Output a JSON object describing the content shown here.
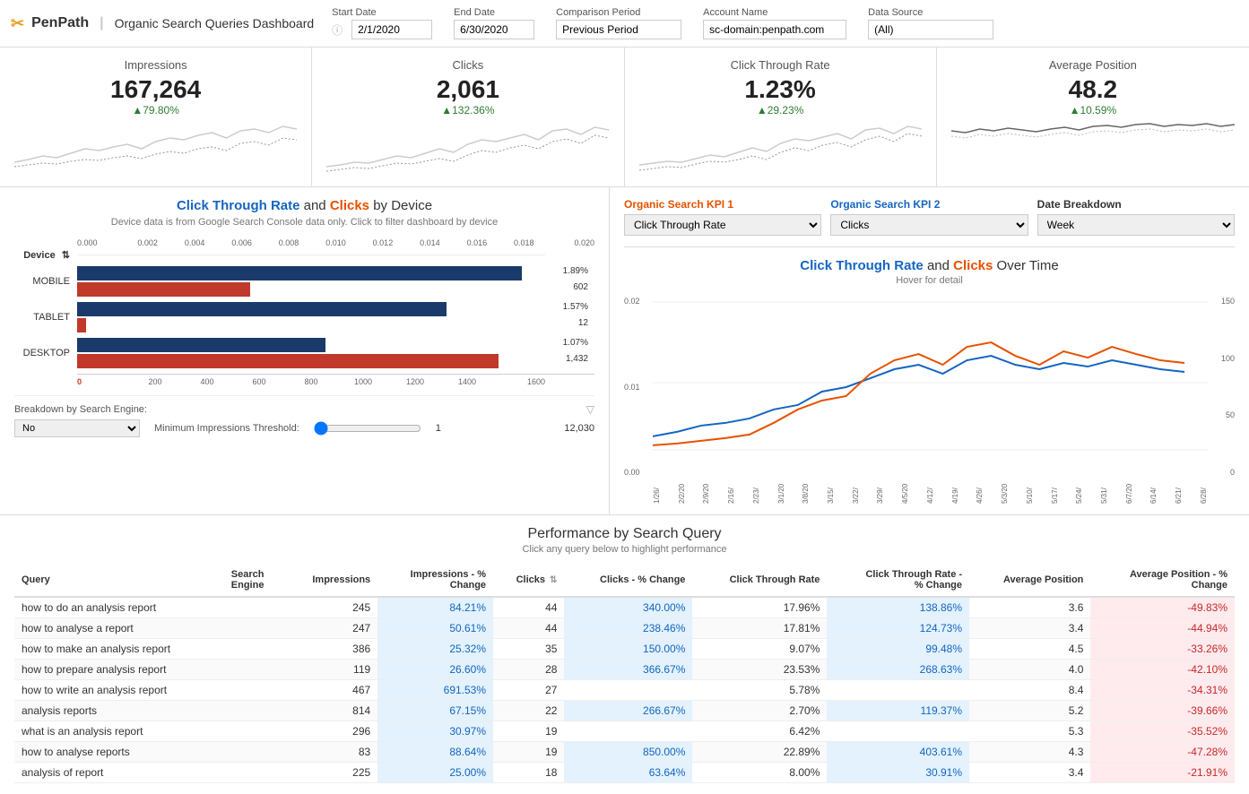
{
  "header": {
    "logo_icon": "✂",
    "logo_text": "PenPath",
    "logo_divider": "|",
    "title": "Organic Search Queries Dashboard",
    "info_icon": "ⓘ",
    "start_date_label": "Start Date",
    "start_date_value": "2/1/2020",
    "end_date_label": "End Date",
    "end_date_value": "6/30/2020",
    "comparison_label": "Comparison Period",
    "comparison_value": "Previous Period",
    "account_label": "Account Name",
    "account_value": "sc-domain:penpath.com",
    "datasource_label": "Data Source",
    "datasource_value": "(All)"
  },
  "kpis": [
    {
      "title": "Impressions",
      "value": "167,264",
      "change": "▲79.80%",
      "change_type": "up"
    },
    {
      "title": "Clicks",
      "value": "2,061",
      "change": "▲132.36%",
      "change_type": "up"
    },
    {
      "title": "Click Through Rate",
      "value": "1.23%",
      "change": "▲29.23%",
      "change_type": "up"
    },
    {
      "title": "Average Position",
      "value": "48.2",
      "change": "▲10.59%",
      "change_type": "up"
    }
  ],
  "device_chart": {
    "title_blue": "Click Through Rate",
    "title_and": " and ",
    "title_orange": "Clicks",
    "title_suffix": " by Device",
    "subtitle": "Device data is from Google Search Console data only. Click to filter dashboard by device",
    "device_label": "Device",
    "rows": [
      {
        "label": "MOBILE",
        "ctr_pct": 95,
        "ctr_value": "1.89%",
        "clicks_pct": 37,
        "clicks_value": "602"
      },
      {
        "label": "TABLET",
        "ctr_pct": 79,
        "ctr_value": "1.57%",
        "clicks_pct": 1,
        "clicks_value": "12"
      },
      {
        "label": "DESKTOP",
        "ctr_pct": 53,
        "ctr_value": "1.07%",
        "clicks_pct": 89,
        "clicks_value": "1,432"
      }
    ],
    "x_axis": [
      "0",
      "200",
      "400",
      "600",
      "800",
      "1000",
      "1200",
      "1400",
      "1600"
    ],
    "x_axis_ctr": [
      "0.000",
      "0.002",
      "0.004",
      "0.006",
      "0.008",
      "0.010",
      "0.012",
      "0.014",
      "0.016",
      "0.018",
      "0.020"
    ],
    "breakdown_label": "Breakdown by Search Engine:",
    "breakdown_value": "No",
    "threshold_label": "Minimum Impressions Threshold:",
    "threshold_min": "1",
    "threshold_max": "12,030"
  },
  "kpi_selectors": [
    {
      "title": "Organic Search KPI 1",
      "title_color": "orange",
      "value": "Click Through Rate"
    },
    {
      "title": "Organic Search KPI 2",
      "title_color": "blue",
      "value": "Clicks"
    },
    {
      "title": "Date Breakdown",
      "title_color": "black",
      "value": "Week"
    }
  ],
  "line_chart": {
    "title_blue": "Click Through Rate",
    "title_and": " and ",
    "title_orange": "Clicks",
    "title_suffix": " Over Time",
    "subtitle": "Hover for detail",
    "y_left": [
      "0.02",
      "0.01",
      "0.00"
    ],
    "y_right": [
      "150",
      "100",
      "50",
      "0"
    ],
    "x_labels": [
      "1/26/",
      "2/2/20",
      "2/9/20",
      "2/16/",
      "2/23/",
      "3/1/20",
      "3/8/20",
      "3/15/",
      "3/22/",
      "3/29/",
      "4/5/20",
      "4/12/",
      "4/19/",
      "4/26/",
      "5/3/20",
      "5/10/",
      "5/17/",
      "5/24/",
      "5/31/",
      "6/7/20",
      "6/14/",
      "6/21/",
      "6/28/"
    ]
  },
  "table": {
    "title": "Performance by Search Query",
    "subtitle": "Click any query below to highlight performance",
    "headers": [
      "Query",
      "Search Engine",
      "Impressions",
      "Impressions - % Change",
      "Clicks",
      "Clicks - % Change",
      "Click Through Rate",
      "Click Through Rate - % Change",
      "Average Position",
      "Average Position - % Change"
    ],
    "rows": [
      {
        "query": "how to do an analysis report",
        "engine": "",
        "impressions": "245",
        "imp_change": "84.21%",
        "clicks": "44",
        "clicks_change": "340.00%",
        "ctr": "17.96%",
        "ctr_change": "138.86%",
        "avg_pos": "3.6",
        "avg_pos_change": "-49.83%"
      },
      {
        "query": "how to analyse a report",
        "engine": "",
        "impressions": "247",
        "imp_change": "50.61%",
        "clicks": "44",
        "clicks_change": "238.46%",
        "ctr": "17.81%",
        "ctr_change": "124.73%",
        "avg_pos": "3.4",
        "avg_pos_change": "-44.94%"
      },
      {
        "query": "how to make an analysis report",
        "engine": "",
        "impressions": "386",
        "imp_change": "25.32%",
        "clicks": "35",
        "clicks_change": "150.00%",
        "ctr": "9.07%",
        "ctr_change": "99.48%",
        "avg_pos": "4.5",
        "avg_pos_change": "-33.26%"
      },
      {
        "query": "how to prepare analysis report",
        "engine": "",
        "impressions": "119",
        "imp_change": "26.60%",
        "clicks": "28",
        "clicks_change": "366.67%",
        "ctr": "23.53%",
        "ctr_change": "268.63%",
        "avg_pos": "4.0",
        "avg_pos_change": "-42.10%"
      },
      {
        "query": "how to write an analysis report",
        "engine": "",
        "impressions": "467",
        "imp_change": "691.53%",
        "clicks": "27",
        "clicks_change": "",
        "ctr": "5.78%",
        "ctr_change": "",
        "avg_pos": "8.4",
        "avg_pos_change": "-34.31%"
      },
      {
        "query": "analysis reports",
        "engine": "",
        "impressions": "814",
        "imp_change": "67.15%",
        "clicks": "22",
        "clicks_change": "266.67%",
        "ctr": "2.70%",
        "ctr_change": "119.37%",
        "avg_pos": "5.2",
        "avg_pos_change": "-39.66%"
      },
      {
        "query": "what is an analysis report",
        "engine": "",
        "impressions": "296",
        "imp_change": "30.97%",
        "clicks": "19",
        "clicks_change": "",
        "ctr": "6.42%",
        "ctr_change": "",
        "avg_pos": "5.3",
        "avg_pos_change": "-35.52%"
      },
      {
        "query": "how to analyse reports",
        "engine": "",
        "impressions": "83",
        "imp_change": "88.64%",
        "clicks": "19",
        "clicks_change": "850.00%",
        "ctr": "22.89%",
        "ctr_change": "403.61%",
        "avg_pos": "4.3",
        "avg_pos_change": "-47.28%"
      },
      {
        "query": "analysis of report",
        "engine": "",
        "impressions": "225",
        "imp_change": "25.00%",
        "clicks": "18",
        "clicks_change": "63.64%",
        "ctr": "8.00%",
        "ctr_change": "30.91%",
        "avg_pos": "3.4",
        "avg_pos_change": "-21.91%"
      }
    ]
  }
}
